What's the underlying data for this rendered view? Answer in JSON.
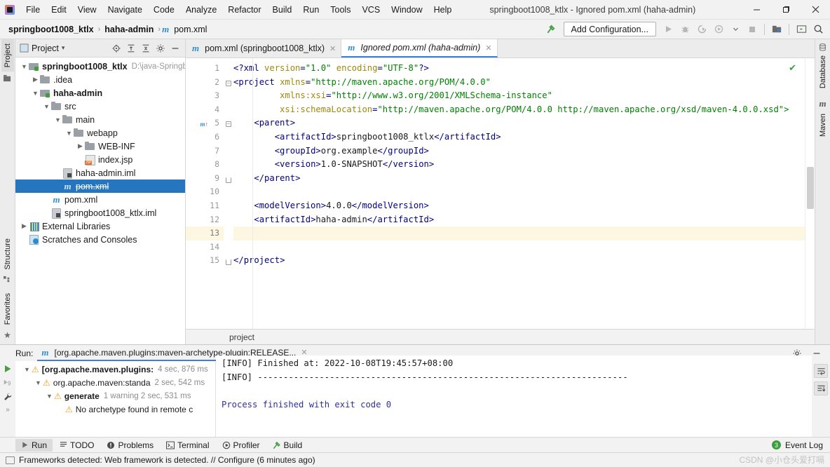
{
  "window": {
    "title": "springboot1008_ktlx - Ignored pom.xml (haha-admin)",
    "minimize": "—",
    "maximize": "❐",
    "close": "✕"
  },
  "menu": [
    "File",
    "Edit",
    "View",
    "Navigate",
    "Code",
    "Analyze",
    "Refactor",
    "Build",
    "Run",
    "Tools",
    "VCS",
    "Window",
    "Help"
  ],
  "breadcrumb": {
    "items": [
      "springboot1008_ktlx",
      "haha-admin",
      "pom.xml"
    ],
    "separator": "›",
    "maven_badge": "m"
  },
  "toolbar": {
    "add_configuration": "Add Configuration...",
    "run_icon": "run-icon",
    "debug_icon": "debug-icon",
    "run_coverage_icon": "run-with-coverage-icon",
    "profile_icon": "profile-icon",
    "stop_icon": "stop-icon",
    "build_icon": "build-project-icon",
    "search_icon": "search-everywhere-icon",
    "updates_icon": "updates-icon"
  },
  "left_stripe": {
    "top": [
      "Project"
    ],
    "bottom": [
      "Structure",
      "Favorites"
    ]
  },
  "right_stripe": [
    "Database",
    "Maven"
  ],
  "project_pane": {
    "title": "Project",
    "icons": [
      "locate-icon",
      "expand-all-icon",
      "collapse-all-icon",
      "gear-icon",
      "hide-icon"
    ],
    "tree": [
      {
        "depth": 0,
        "twisty": "v",
        "icon": "folder-module",
        "label": "springboot1008_ktlx",
        "bold": true,
        "sub": "D:\\java-Springbo",
        "strike": false,
        "selected": false
      },
      {
        "depth": 1,
        "twisty": ">",
        "icon": "folder",
        "label": ".idea",
        "bold": false,
        "sub": "",
        "strike": false,
        "selected": false
      },
      {
        "depth": 1,
        "twisty": "v",
        "icon": "folder-module",
        "label": "haha-admin",
        "bold": true,
        "sub": "",
        "strike": false,
        "selected": false
      },
      {
        "depth": 2,
        "twisty": "v",
        "icon": "folder",
        "label": "src",
        "bold": false,
        "sub": "",
        "strike": false,
        "selected": false
      },
      {
        "depth": 3,
        "twisty": "v",
        "icon": "folder",
        "label": "main",
        "bold": false,
        "sub": "",
        "strike": false,
        "selected": false
      },
      {
        "depth": 4,
        "twisty": "v",
        "icon": "folder",
        "label": "webapp",
        "bold": false,
        "sub": "",
        "strike": false,
        "selected": false
      },
      {
        "depth": 5,
        "twisty": ">",
        "icon": "folder",
        "label": "WEB-INF",
        "bold": false,
        "sub": "",
        "strike": false,
        "selected": false
      },
      {
        "depth": 5,
        "twisty": "",
        "icon": "jsp",
        "label": "index.jsp",
        "bold": false,
        "sub": "",
        "strike": false,
        "selected": false
      },
      {
        "depth": 3,
        "twisty": "",
        "icon": "iml",
        "label": "haha-admin.iml",
        "bold": false,
        "sub": "",
        "strike": false,
        "selected": false
      },
      {
        "depth": 3,
        "twisty": "",
        "icon": "maven",
        "label": "pom.xml",
        "bold": false,
        "sub": "",
        "strike": true,
        "selected": true
      },
      {
        "depth": 2,
        "twisty": "",
        "icon": "maven",
        "label": "pom.xml",
        "bold": false,
        "sub": "",
        "strike": false,
        "selected": false
      },
      {
        "depth": 2,
        "twisty": "",
        "icon": "iml",
        "label": "springboot1008_ktlx.iml",
        "bold": false,
        "sub": "",
        "strike": false,
        "selected": false
      },
      {
        "depth": 0,
        "twisty": ">",
        "icon": "lib",
        "label": "External Libraries",
        "bold": false,
        "sub": "",
        "strike": false,
        "selected": false
      },
      {
        "depth": 0,
        "twisty": "",
        "icon": "scratch",
        "label": "Scratches and Consoles",
        "bold": false,
        "sub": "",
        "strike": false,
        "selected": false
      }
    ]
  },
  "editor": {
    "tabs": [
      {
        "label": "pom.xml (springboot1008_ktlx)",
        "active": false,
        "icon": "maven-file-icon",
        "close": "✕"
      },
      {
        "label": "Ignored pom.xml (haha-admin)",
        "active": true,
        "icon": "maven-file-icon",
        "close": "✕"
      }
    ],
    "breadcrumb": "project",
    "inspection_status": "✔",
    "current_line": 13,
    "gutter_marker": {
      "line": 5,
      "label": "m",
      "arrow": "↑"
    },
    "lines": [
      {
        "n": 1,
        "fold": "",
        "tokens": [
          {
            "t": "<?xml ",
            "c": "pi"
          },
          {
            "t": "version",
            "c": "attr"
          },
          {
            "t": "=",
            "c": "punc"
          },
          {
            "t": "\"1.0\"",
            "c": "val"
          },
          {
            "t": " ",
            "c": "txt"
          },
          {
            "t": "encoding",
            "c": "attr"
          },
          {
            "t": "=",
            "c": "punc"
          },
          {
            "t": "\"UTF-8\"",
            "c": "val"
          },
          {
            "t": "?>",
            "c": "pi"
          }
        ],
        "indent": 0
      },
      {
        "n": 2,
        "fold": "-",
        "tokens": [
          {
            "t": "<",
            "c": "punc"
          },
          {
            "t": "project",
            "c": "tag"
          },
          {
            "t": " ",
            "c": "txt"
          },
          {
            "t": "xmlns",
            "c": "attr"
          },
          {
            "t": "=",
            "c": "punc"
          },
          {
            "t": "\"http://maven.apache.org/POM/4.0.0\"",
            "c": "val"
          }
        ],
        "indent": 0
      },
      {
        "n": 3,
        "fold": "",
        "tokens": [
          {
            "t": "         ",
            "c": "txt"
          },
          {
            "t": "xmlns:xsi",
            "c": "attr"
          },
          {
            "t": "=",
            "c": "punc"
          },
          {
            "t": "\"http://www.w3.org/2001/XMLSchema-instance\"",
            "c": "val"
          }
        ],
        "indent": 0
      },
      {
        "n": 4,
        "fold": "",
        "tokens": [
          {
            "t": "         ",
            "c": "txt"
          },
          {
            "t": "xsi:schemaLocation",
            "c": "attr"
          },
          {
            "t": "=",
            "c": "punc"
          },
          {
            "t": "\"http://maven.apache.org/POM/4.0.0 http://maven.apache.org/xsd/maven-4.0.0.xsd\">",
            "c": "val"
          }
        ],
        "indent": 0
      },
      {
        "n": 5,
        "fold": "-",
        "tokens": [
          {
            "t": "    <",
            "c": "punc"
          },
          {
            "t": "parent",
            "c": "tag"
          },
          {
            "t": ">",
            "c": "punc"
          }
        ],
        "indent": 0
      },
      {
        "n": 6,
        "fold": "",
        "tokens": [
          {
            "t": "        <",
            "c": "punc"
          },
          {
            "t": "artifactId",
            "c": "tag"
          },
          {
            "t": ">",
            "c": "punc"
          },
          {
            "t": "springboot1008_ktlx",
            "c": "txt"
          },
          {
            "t": "</",
            "c": "punc"
          },
          {
            "t": "artifactId",
            "c": "tag"
          },
          {
            "t": ">",
            "c": "punc"
          }
        ],
        "indent": 0
      },
      {
        "n": 7,
        "fold": "",
        "tokens": [
          {
            "t": "        <",
            "c": "punc"
          },
          {
            "t": "groupId",
            "c": "tag"
          },
          {
            "t": ">",
            "c": "punc"
          },
          {
            "t": "org.example",
            "c": "txt"
          },
          {
            "t": "</",
            "c": "punc"
          },
          {
            "t": "groupId",
            "c": "tag"
          },
          {
            "t": ">",
            "c": "punc"
          }
        ],
        "indent": 0
      },
      {
        "n": 8,
        "fold": "",
        "tokens": [
          {
            "t": "        <",
            "c": "punc"
          },
          {
            "t": "version",
            "c": "tag"
          },
          {
            "t": ">",
            "c": "punc"
          },
          {
            "t": "1.0-SNAPSHOT",
            "c": "txt"
          },
          {
            "t": "</",
            "c": "punc"
          },
          {
            "t": "version",
            "c": "tag"
          },
          {
            "t": ">",
            "c": "punc"
          }
        ],
        "indent": 0
      },
      {
        "n": 9,
        "fold": "u",
        "tokens": [
          {
            "t": "    </",
            "c": "punc"
          },
          {
            "t": "parent",
            "c": "tag"
          },
          {
            "t": ">",
            "c": "punc"
          }
        ],
        "indent": 0
      },
      {
        "n": 10,
        "fold": "",
        "tokens": [],
        "indent": 0
      },
      {
        "n": 11,
        "fold": "",
        "tokens": [
          {
            "t": "    <",
            "c": "punc"
          },
          {
            "t": "modelVersion",
            "c": "tag"
          },
          {
            "t": ">",
            "c": "punc"
          },
          {
            "t": "4.0.0",
            "c": "txt"
          },
          {
            "t": "</",
            "c": "punc"
          },
          {
            "t": "modelVersion",
            "c": "tag"
          },
          {
            "t": ">",
            "c": "punc"
          }
        ],
        "indent": 0
      },
      {
        "n": 12,
        "fold": "",
        "tokens": [
          {
            "t": "    <",
            "c": "punc"
          },
          {
            "t": "artifactId",
            "c": "tag"
          },
          {
            "t": ">",
            "c": "punc"
          },
          {
            "t": "haha-admin",
            "c": "txt"
          },
          {
            "t": "</",
            "c": "punc"
          },
          {
            "t": "artifactId",
            "c": "tag"
          },
          {
            "t": ">",
            "c": "punc"
          }
        ],
        "indent": 0
      },
      {
        "n": 13,
        "fold": "",
        "tokens": [],
        "indent": 0
      },
      {
        "n": 14,
        "fold": "",
        "tokens": [],
        "indent": 0
      },
      {
        "n": 15,
        "fold": "u",
        "tokens": [
          {
            "t": "</",
            "c": "punc"
          },
          {
            "t": "project",
            "c": "tag"
          },
          {
            "t": ">",
            "c": "punc"
          }
        ],
        "indent": 0
      }
    ]
  },
  "run_window": {
    "label": "Run:",
    "tab_title": "[org.apache.maven.plugins:maven-archetype-plugin:RELEASE...",
    "tab_icon": "maven-icon",
    "tab_close": "✕",
    "side_icons": [
      "rerun-icon",
      "rerun-failed-icon",
      "settings-wrench-icon",
      "more-icon"
    ],
    "header_icons": [
      "gear-icon",
      "hide-icon"
    ],
    "right_icons": [
      "soft-wrap-icon",
      "scroll-to-end-icon"
    ],
    "tree": [
      {
        "depth": 0,
        "twisty": "v",
        "label": "[org.apache.maven.plugins:",
        "time": "4 sec, 876 ms",
        "bold": true,
        "warning": true
      },
      {
        "depth": 1,
        "twisty": "v",
        "label": "org.apache.maven:standa",
        "time": "2 sec, 542 ms",
        "bold": false,
        "warning": true
      },
      {
        "depth": 2,
        "twisty": "v",
        "label": "generate",
        "time": "1 warning    2 sec, 531 ms",
        "bold": true,
        "warning": true
      },
      {
        "depth": 3,
        "twisty": "",
        "label": "No archetype found in remote c",
        "time": "",
        "bold": false,
        "warning": true
      }
    ],
    "console": [
      {
        "text": "[INFO] Finished at: 2022-10-08T19:45:57+08:00",
        "blue": false
      },
      {
        "text": "[INFO] ------------------------------------------------------------------------",
        "blue": false
      },
      {
        "text": "",
        "blue": false
      },
      {
        "text": "Process finished with exit code 0",
        "blue": true
      }
    ]
  },
  "bottom_toolbar": {
    "items": [
      {
        "label": "Run",
        "icon": "run-icon",
        "selected": true
      },
      {
        "label": "TODO",
        "icon": "todo-icon",
        "selected": false
      },
      {
        "label": "Problems",
        "icon": "problems-icon",
        "selected": false
      },
      {
        "label": "Terminal",
        "icon": "terminal-icon",
        "selected": false
      },
      {
        "label": "Profiler",
        "icon": "profiler-icon",
        "selected": false
      },
      {
        "label": "Build",
        "icon": "build-icon",
        "selected": false
      }
    ],
    "event_log": {
      "label": "Event Log",
      "count": "3"
    }
  },
  "statusbar": {
    "message": "Frameworks detected: Web framework is detected. // Configure (6 minutes ago)",
    "icon": "notification-icon"
  },
  "watermark": "CSDN @小仓头爱打嗝",
  "colors": {
    "accent": "#2675bf",
    "tab_underline": "#3f7fd4",
    "warning": "#e8a317",
    "success": "#3a9e3a",
    "caret_line": "#fdf7e2"
  }
}
